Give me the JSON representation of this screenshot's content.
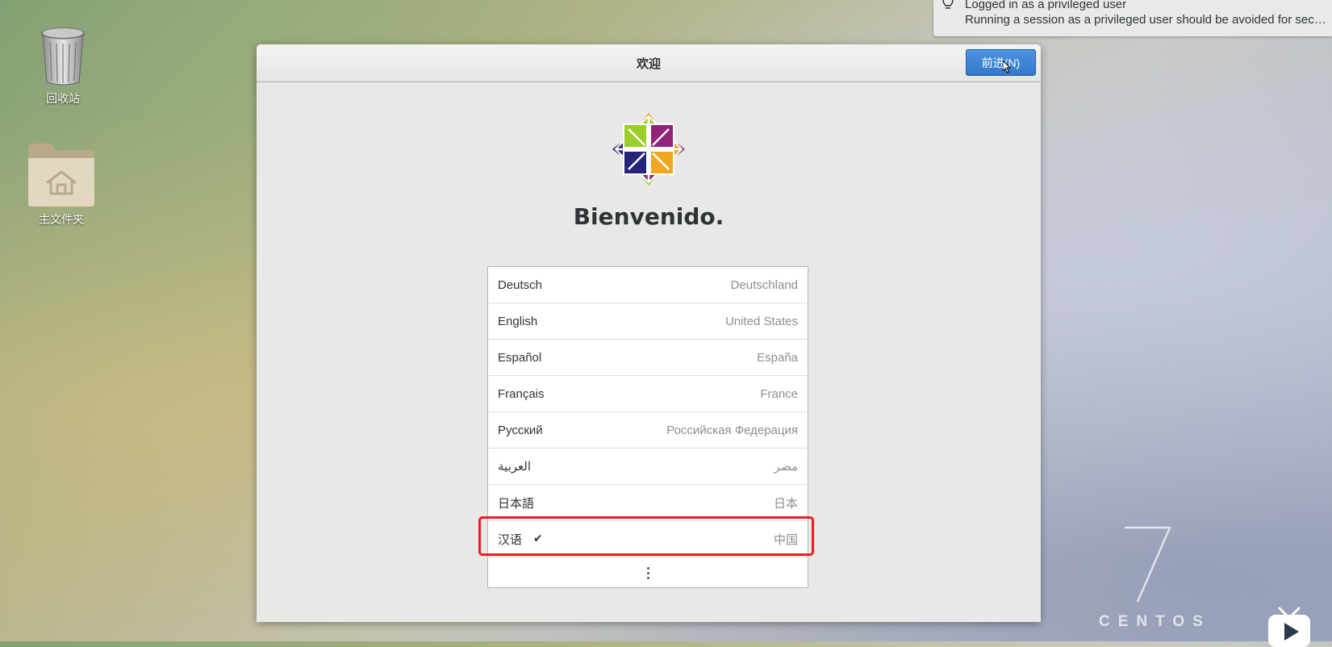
{
  "desktop": {
    "icons": [
      {
        "label": "回收站",
        "icon": "trash-icon"
      },
      {
        "label": "主文件夹",
        "icon": "home-folder-icon"
      }
    ]
  },
  "notification": {
    "title": "Logged in as a privileged user",
    "body": "Running a session as a privileged user should be avoided for securit…",
    "icon": "lightbulb-icon"
  },
  "window": {
    "title": "欢迎",
    "next_label": "前进(N)",
    "welcome_text": "Bienvenido.",
    "logo": "centos-logo",
    "languages": [
      {
        "name": "Deutsch",
        "region": "Deutschland",
        "selected": false
      },
      {
        "name": "English",
        "region": "United States",
        "selected": false
      },
      {
        "name": "Español",
        "region": "España",
        "selected": false
      },
      {
        "name": "Français",
        "region": "France",
        "selected": false
      },
      {
        "name": "Русский",
        "region": "Российская Федерация",
        "selected": false
      },
      {
        "name": "العربية",
        "region": "مصر",
        "selected": false
      },
      {
        "name": "日本語",
        "region": "日本",
        "selected": false
      },
      {
        "name": "汉语",
        "region": "中国",
        "selected": true,
        "check": "✔"
      }
    ],
    "more_icon": "vertical-ellipsis-icon"
  },
  "branding": {
    "version": "7",
    "word": "CENTOS"
  },
  "colors": {
    "accent": "#3379cc",
    "highlight": "#ee1c1c"
  }
}
